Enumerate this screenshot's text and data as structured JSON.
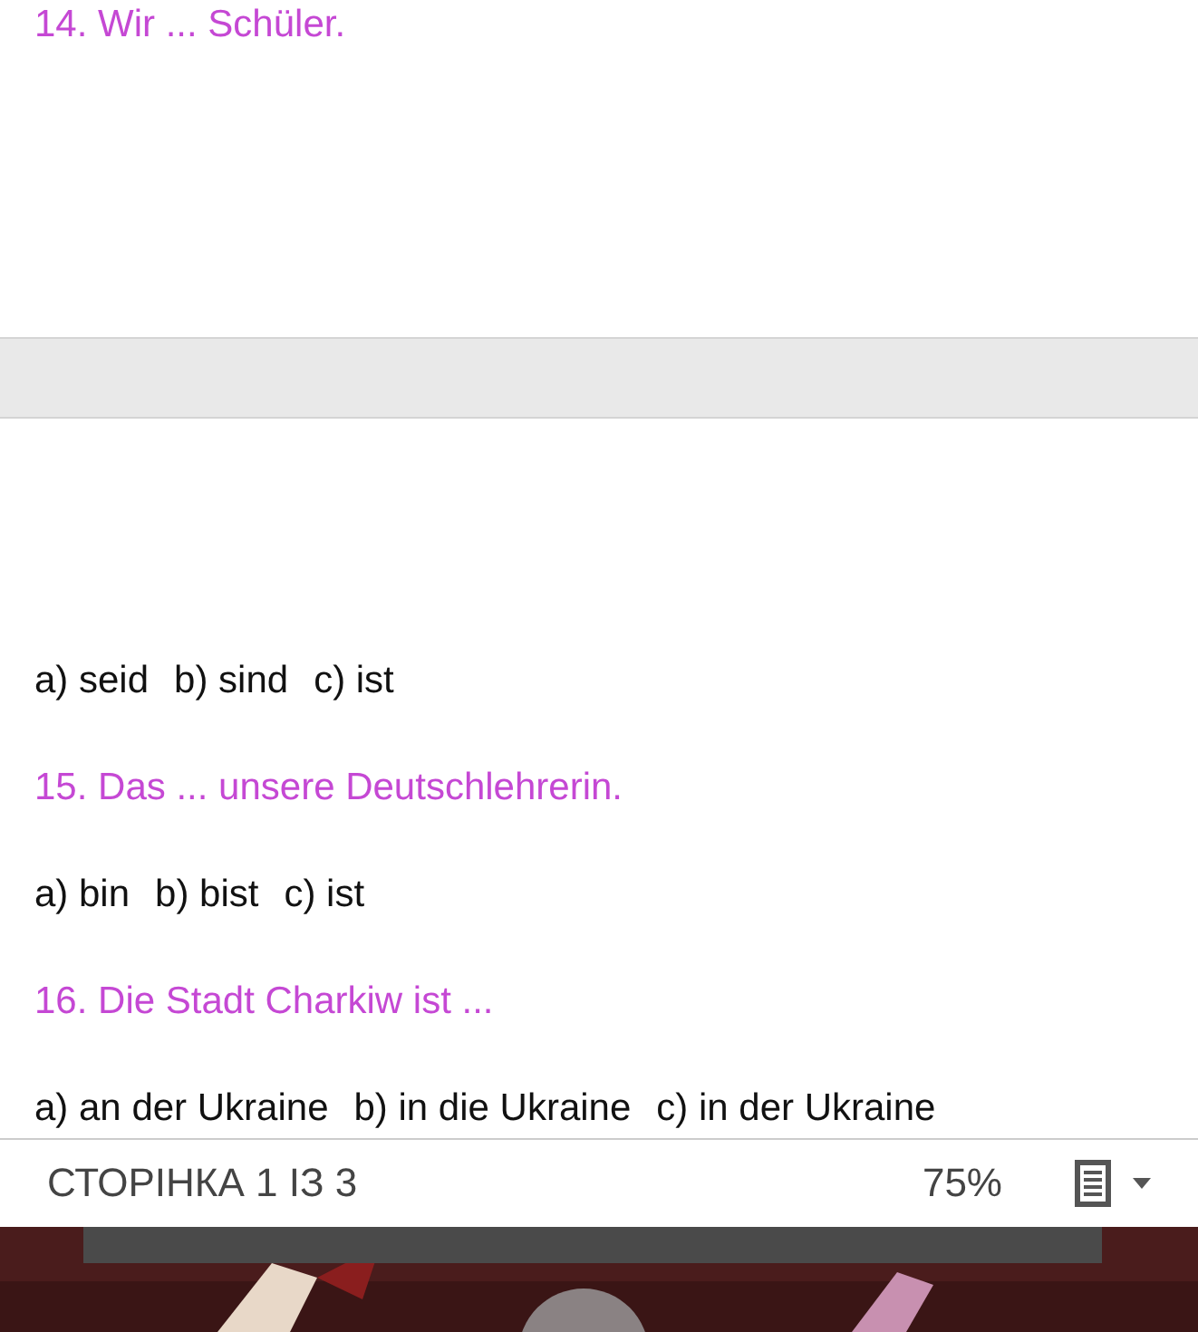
{
  "pages": [
    {
      "lines": [
        {
          "kind": "question",
          "text": "14. Wir ... Schüler."
        }
      ]
    },
    {
      "lines": [
        {
          "kind": "answer",
          "options": [
            "a) seid",
            "b) sind",
            "c) ist"
          ]
        },
        {
          "kind": "question",
          "text": "15. Das ... unsere Deutschlehrerin."
        },
        {
          "kind": "answer",
          "options": [
            "a) bin",
            "b) bist",
            "c) ist"
          ]
        },
        {
          "kind": "question",
          "text": "16. Die Stadt Charkiw ist ..."
        },
        {
          "kind": "answer",
          "options": [
            "a) an der Ukraine",
            "b) in die Ukraine",
            "c) in der Ukraine"
          ]
        }
      ]
    }
  ],
  "status_bar": {
    "page_label": "СТОРІНКА 1 ІЗ 3",
    "zoom": "75%"
  }
}
